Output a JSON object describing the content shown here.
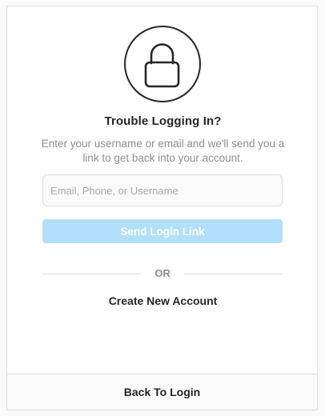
{
  "header": {
    "icon": "lock-icon",
    "title": "Trouble Logging In?",
    "subtitle": "Enter your username or email and we'll send you a link to get back into your account."
  },
  "form": {
    "input_placeholder": "Email, Phone, or Username",
    "input_value": "",
    "send_label": "Send Login Link",
    "send_color": "#b2dffc"
  },
  "divider": {
    "label": "OR"
  },
  "links": {
    "create_account": "Create New Account",
    "back_to_login": "Back To Login"
  }
}
